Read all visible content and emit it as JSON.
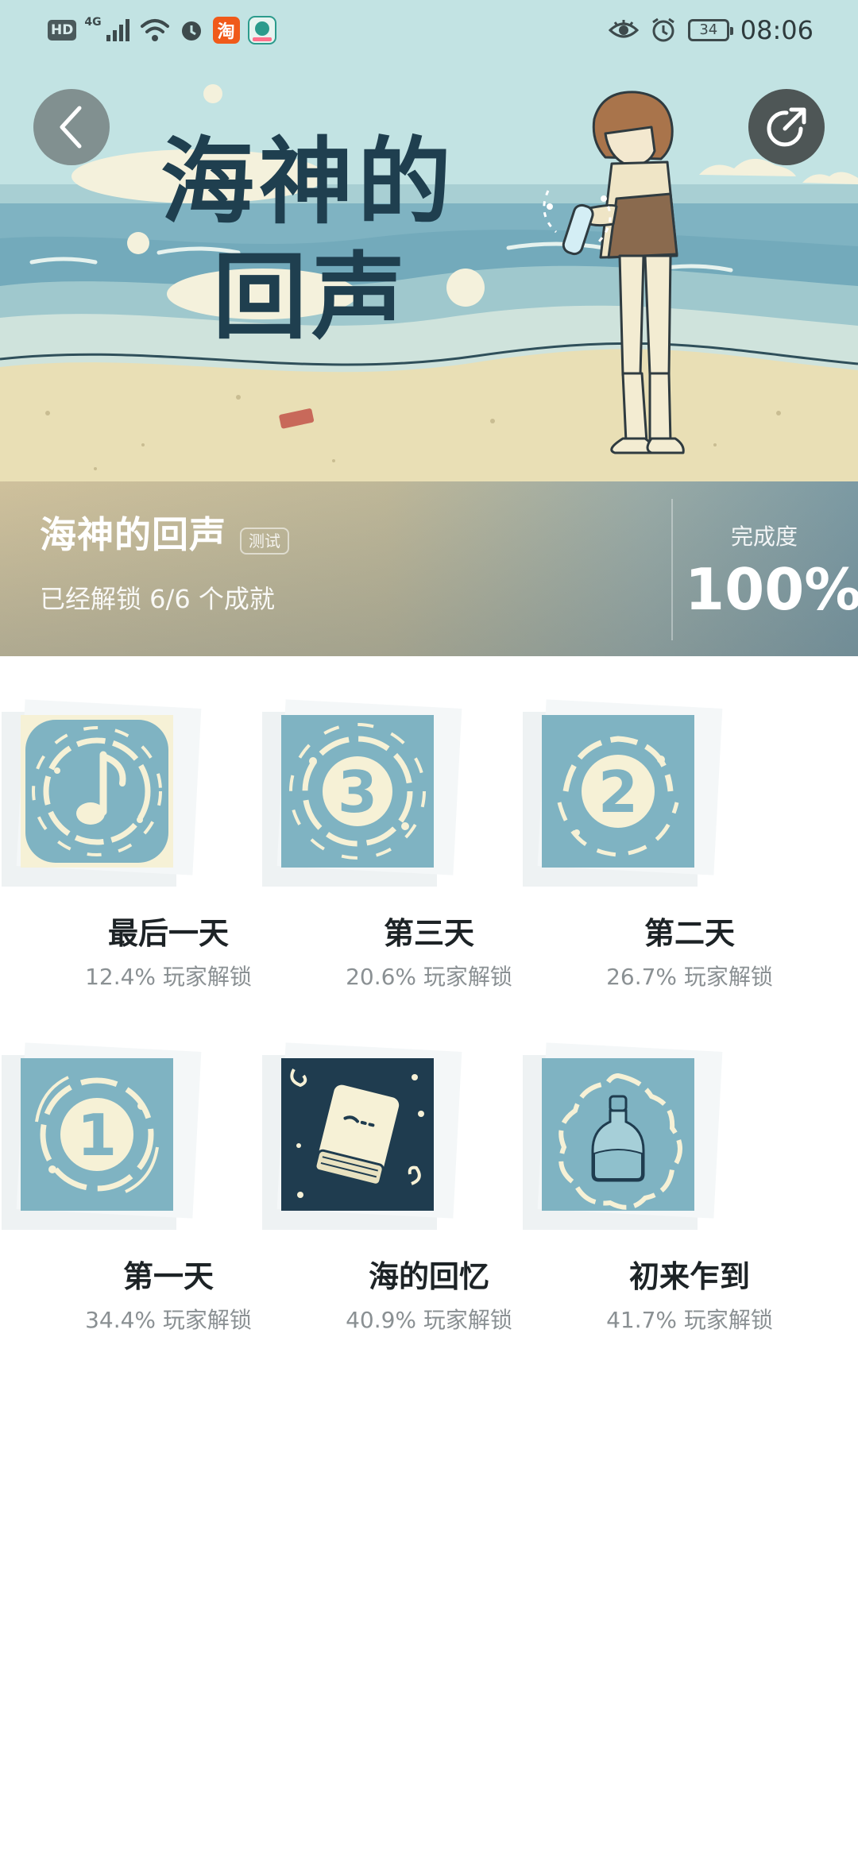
{
  "status_bar": {
    "hd": "HD",
    "network": "4G",
    "app_taobao": "淘",
    "battery": "34",
    "time": "08:06",
    "icons": [
      "signal-icon",
      "wifi-icon",
      "alarm-icon",
      "taobao-app-icon",
      "app-icon",
      "eye-icon",
      "alarm-icon",
      "battery-icon"
    ]
  },
  "hero": {
    "artwork_title": "海神的回声",
    "back_icon": "chevron-left-icon",
    "share_icon": "share-icon"
  },
  "game": {
    "title": "海神的回声",
    "tag": "测试",
    "unlock_summary": "已经解锁 6/6 个成就",
    "completion_label": "完成度",
    "completion_value": "100%"
  },
  "achievements": [
    {
      "name": "最后一天",
      "rate": "12.4% 玩家解锁",
      "icon": "music-note-icon"
    },
    {
      "name": "第三天",
      "rate": "20.6% 玩家解锁",
      "icon": "number-3-icon"
    },
    {
      "name": "第二天",
      "rate": "26.7% 玩家解锁",
      "icon": "number-2-icon"
    },
    {
      "name": "第一天",
      "rate": "34.4% 玩家解锁",
      "icon": "number-1-icon"
    },
    {
      "name": "海的回忆",
      "rate": "40.9% 玩家解锁",
      "icon": "book-icon"
    },
    {
      "name": "初来乍到",
      "rate": "41.7% 玩家解锁",
      "icon": "bottle-icon"
    }
  ],
  "colors": {
    "sea": "#7fb3c2",
    "sand": "#e9dfb5",
    "icon_bg": "#7fb3c2",
    "icon_fg": "#f6f1d6",
    "navy_icon_bg": "#1f3c4f"
  }
}
